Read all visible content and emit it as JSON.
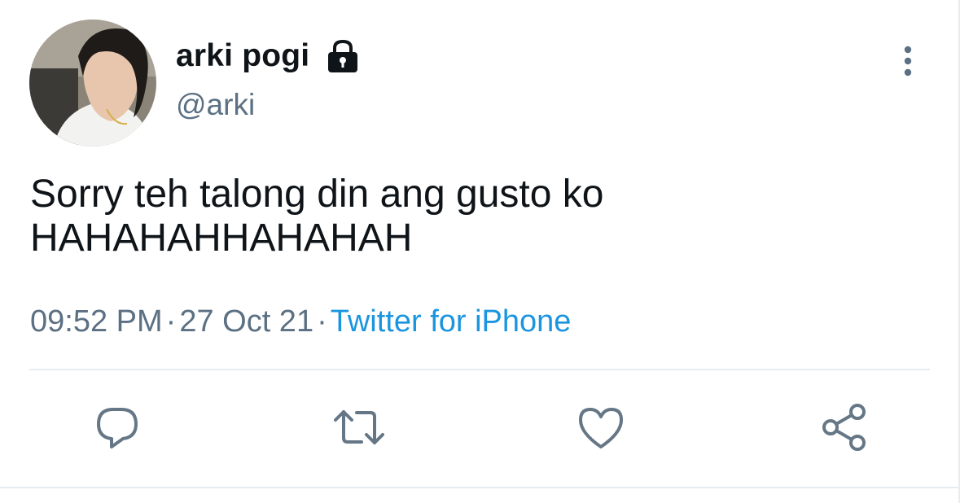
{
  "tweet": {
    "display_name": "arki pogi",
    "handle": "@arki",
    "text": "Sorry teh talong din ang gusto ko\nHAHAHAHHAHAHAH",
    "time": "09:52 PM",
    "separator": "·",
    "date": "27 Oct 21",
    "source": "Twitter for iPhone",
    "protected": true
  },
  "icons": {
    "lock": "lock-icon",
    "more": "more-vertical-icon",
    "reply": "reply-icon",
    "retweet": "retweet-icon",
    "like": "heart-icon",
    "share": "share-icon"
  },
  "colors": {
    "text": "#0f1419",
    "secondary": "#5b7083",
    "link": "#1b95e0",
    "icon": "#657786",
    "divider": "#e6ecf0"
  }
}
